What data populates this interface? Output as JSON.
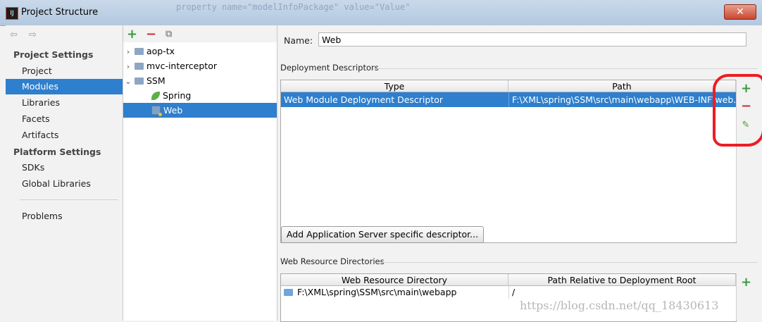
{
  "window": {
    "title": "Project Structure",
    "close_glyph": "✕",
    "background_code": "property name=\"modelInfoPackage\" value=\"Value\""
  },
  "nav": {
    "back_glyph": "⇦",
    "forward_glyph": "⇨"
  },
  "sidebar": {
    "project_settings_header": "Project Settings",
    "project_items": [
      "Project",
      "Modules",
      "Libraries",
      "Facets",
      "Artifacts"
    ],
    "platform_settings_header": "Platform Settings",
    "platform_items": [
      "SDKs",
      "Global Libraries"
    ],
    "problems": "Problems",
    "selected": "Modules"
  },
  "tree_toolbar": {
    "add": "+",
    "remove": "−",
    "copy": "⧉"
  },
  "tree": [
    {
      "label": "aop-tx",
      "level": 0,
      "expander": "›",
      "icon": "folder-icon"
    },
    {
      "label": "mvc-interceptor",
      "level": 0,
      "expander": "›",
      "icon": "folder-icon"
    },
    {
      "label": "SSM",
      "level": 0,
      "expander": "⌄",
      "icon": "folder-icon"
    },
    {
      "label": "Spring",
      "level": 1,
      "expander": "",
      "icon": "spring-leaf-icon"
    },
    {
      "label": "Web",
      "level": 1,
      "expander": "",
      "icon": "web-facet-icon",
      "selected": true
    }
  ],
  "detail": {
    "name_label": "Name:",
    "name_value": "Web",
    "deployment_descriptors": {
      "title": "Deployment Descriptors",
      "columns": [
        "Type",
        "Path"
      ],
      "rows": [
        {
          "type": "Web Module Deployment Descriptor",
          "path": "F:\\XML\\spring\\SSM\\src\\main\\webapp\\WEB-INF\\web.xml"
        }
      ],
      "add_server_button": "Add Application Server specific descriptor..."
    },
    "web_resource_directories": {
      "title": "Web Resource Directories",
      "columns": [
        "Web Resource Directory",
        "Path Relative to Deployment Root"
      ],
      "rows": [
        {
          "dir": "F:\\XML\\spring\\SSM\\src\\main\\webapp",
          "relative": "/"
        }
      ]
    },
    "side_buttons": {
      "add": "+",
      "remove": "−",
      "edit": "✎"
    }
  },
  "watermark": "https://blog.csdn.net/qq_18430613",
  "colors": {
    "selection": "#2e7fcd",
    "annotation": "#ee1c24",
    "add": "#3a9a3a",
    "remove": "#cc3333"
  }
}
